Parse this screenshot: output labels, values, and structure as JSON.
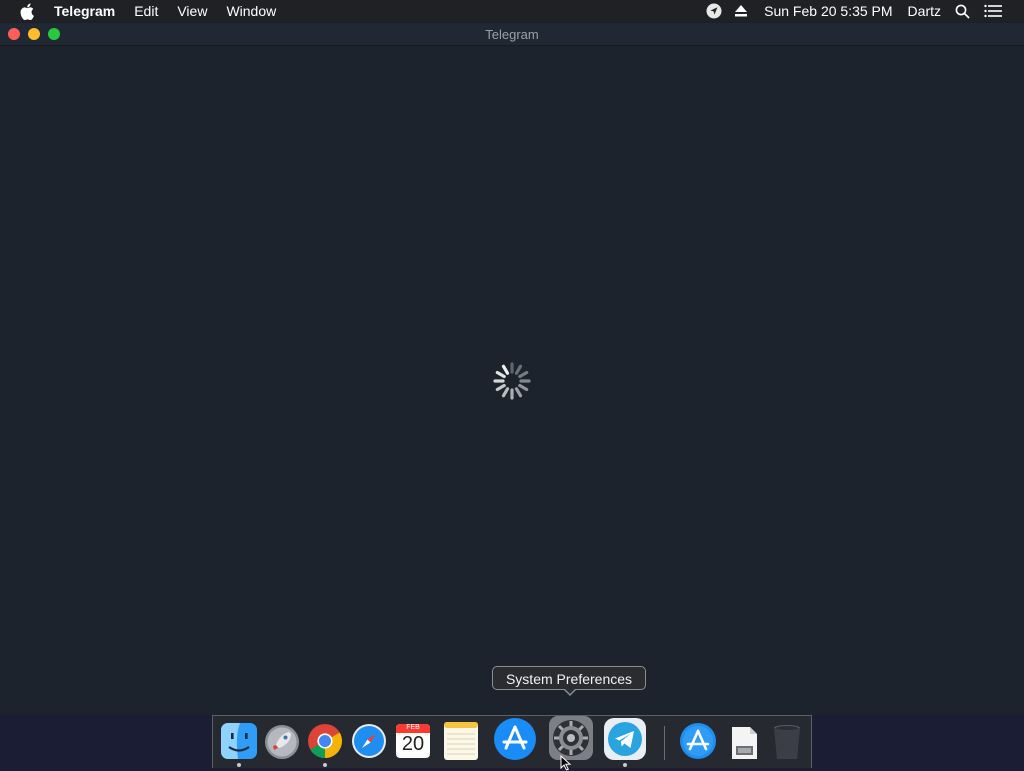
{
  "menubar": {
    "app_name": "Telegram",
    "items": [
      "Edit",
      "View",
      "Window"
    ],
    "clock": "Sun Feb 20  5:35 PM",
    "user": "Dartz",
    "icons": [
      "apple-icon",
      "location-icon",
      "eject-icon",
      "search-icon",
      "list-icon"
    ]
  },
  "window": {
    "title": "Telegram",
    "state": "loading"
  },
  "tooltip": {
    "text": "System Preferences"
  },
  "dock": {
    "items": [
      {
        "name": "Finder",
        "icon": "finder-icon",
        "running": true
      },
      {
        "name": "Launchpad",
        "icon": "rocket-icon",
        "running": false
      },
      {
        "name": "Google Chrome",
        "icon": "chrome-icon",
        "running": true
      },
      {
        "name": "Safari",
        "icon": "compass-icon",
        "running": false
      },
      {
        "name": "Calendar",
        "icon": "calendar-icon",
        "running": false,
        "month": "FEB",
        "day": "20"
      },
      {
        "name": "Notes",
        "icon": "notes-icon",
        "running": false
      },
      {
        "name": "App Store",
        "icon": "app-store-icon",
        "running": false
      },
      {
        "name": "System Preferences",
        "icon": "gear-icon",
        "running": false
      },
      {
        "name": "Telegram",
        "icon": "paper-plane-icon",
        "running": true
      },
      {
        "name": "Applications",
        "icon": "app-store-icon",
        "running": false
      },
      {
        "name": "Document",
        "icon": "document-icon",
        "running": false
      },
      {
        "name": "Trash",
        "icon": "trash-icon",
        "running": false
      }
    ]
  },
  "colors": {
    "menubar_bg": "#1f2124",
    "window_bg": "#1c232d",
    "desktop_bg": "#1a1d33"
  }
}
